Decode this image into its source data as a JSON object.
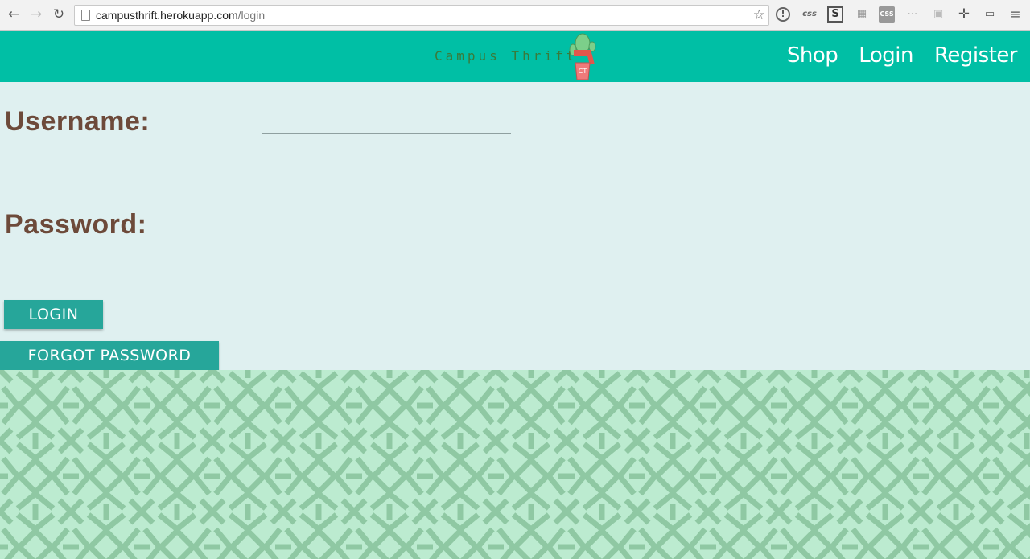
{
  "browser": {
    "url_host": "campusthrift.herokuapp.com",
    "url_path": "/login",
    "ext_css_label": "css",
    "ext_s_label": "S",
    "ext_css2_label": "CSS"
  },
  "site": {
    "logo_text": "Campus Thrift",
    "logo_badge": "CT",
    "nav": [
      "Shop",
      "Login",
      "Register"
    ]
  },
  "form": {
    "username_label": "Username:",
    "password_label": "Password:",
    "username_value": "",
    "password_value": "",
    "login_button": "LOGIN",
    "forgot_button": "FORGOT PASSWORD"
  },
  "colors": {
    "nav_bg": "#00bfa5",
    "page_bg": "#dff0f0",
    "label": "#6d4a3a",
    "button": "#26a69a",
    "pattern_bg": "#bcebd0",
    "pattern_line": "#8fc8a3"
  }
}
